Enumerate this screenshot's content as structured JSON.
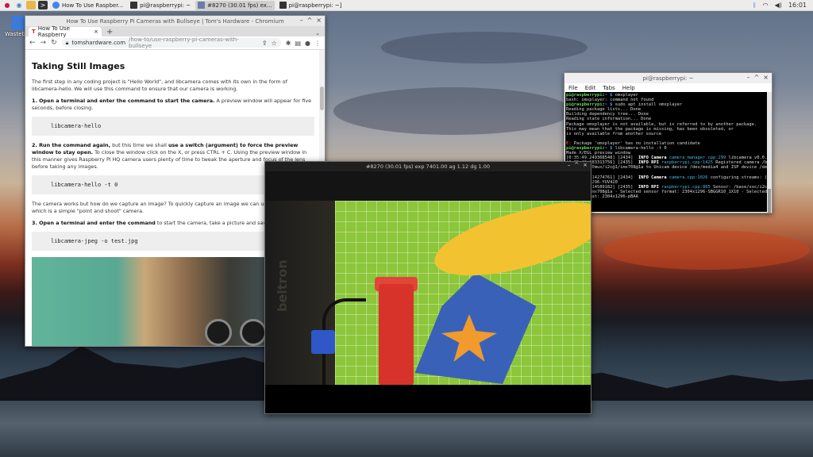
{
  "taskbar": {
    "tasks": [
      {
        "label": "How To Use Raspber..."
      },
      {
        "label": "pi@raspberrypi: ~"
      },
      {
        "label": "#8270 (30.01 fps) ex..."
      },
      {
        "label": "pi@raspberrypi: ~]"
      }
    ],
    "clock": "16:01"
  },
  "desktop": {
    "trash_label": "Wastebasket"
  },
  "browser": {
    "window_title": "How To Use Raspberry Pi Cameras with Bullseye | Tom's Hardware - Chromium",
    "tab_title": "How To Use Raspberry",
    "url_host": "tomshardware.com",
    "url_path": "/how-to/use-raspberry-pi-cameras-with-bullseye",
    "article": {
      "heading": "Taking Still Images",
      "p1": "The first step in any coding project is \"Hello World\", and libcamera comes with its own in the form of libcamera-hello. We will use this command to ensure that our camera is working.",
      "step1_bold": "1. Open a terminal and enter the command to start the camera.",
      "step1_rest": " A preview window will appear for five seconds, before closing.",
      "code1": "libcamera-hello",
      "step2_bold": "2. Run the command again,",
      "step2_mid": " but this time we shall ",
      "step2_bold2": "use a switch (argument) to force the preview window to stay open.",
      "step2_rest": " To close the window click on the X, or press CTRL + C. Using the preview window in this manner gives Raspberry Pi HQ camera users plenty of time to tweak the aperture and focus of the lens before taking any images.",
      "code2": "libcamera-hello -t 0",
      "p3": "The camera works but how do we capture an image? To quickly capture an image we can use libcamera-jpeg which is a simple \"point and shoot\" camera.",
      "step3_bold": "3. Open a terminal and enter the command",
      "step3_rest": " to start the camera, take a picture and save it as test.jpg",
      "code3": "libcamera-jpeg -o test.jpg"
    }
  },
  "terminal": {
    "title": "pi@raspberrypi: ~",
    "menu": [
      "File",
      "Edit",
      "Tabs",
      "Help"
    ]
  },
  "camera": {
    "title": "#8270 (30.01 fps) exp 7401.00 ag 1.12 dg 1.00",
    "mat_text": "beltron"
  }
}
